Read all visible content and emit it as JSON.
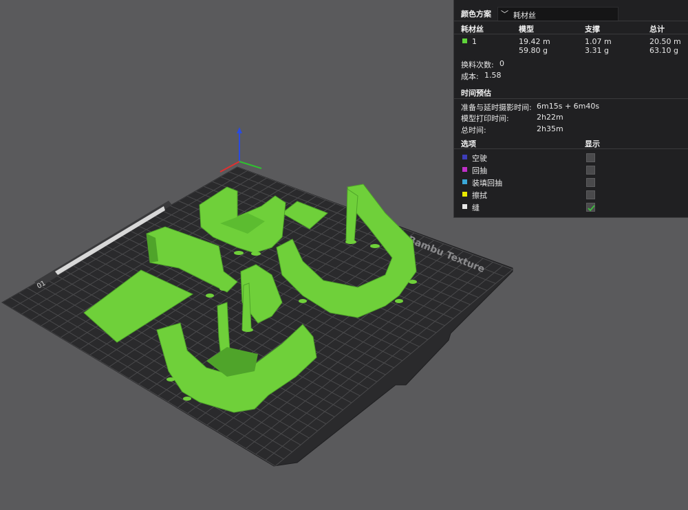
{
  "scene": {
    "bed_brand_text": "Bambu Texture",
    "plate_number": "01",
    "colors": {
      "background": "#5a5a5c",
      "bed": "#2a2a2c",
      "grid": "#4a4a4c",
      "model": "#6fd03a",
      "model_dark": "#4fa42a"
    }
  },
  "panel": {
    "color_scheme_label": "颜色方案",
    "color_scheme_value": "耗材丝",
    "columns": {
      "filament": "耗材丝",
      "model": "模型",
      "support": "支撑",
      "total": "总计"
    },
    "filament_row": {
      "index": "1",
      "color": "#5fd43a",
      "model_length": "19.42 m",
      "model_weight": "59.80 g",
      "support_length": "1.07 m",
      "support_weight": "3.31 g",
      "total_length": "20.50 m",
      "total_weight": "63.10 g"
    },
    "changes_label": "换料次数:",
    "changes_value": "0",
    "cost_label": "成本:",
    "cost_value": "1.58",
    "time_header": "时间预估",
    "prep_label": "准备与延时摄影时间:",
    "prep_value": "6m15s + 6m40s",
    "print_label": "模型打印时间:",
    "print_value": "2h22m",
    "total_time_label": "总时间:",
    "total_time_value": "2h35m",
    "options_header": "选项",
    "display_header": "显示",
    "options": [
      {
        "label": "空驶",
        "color": "#3d3db8",
        "checked": false
      },
      {
        "label": "回抽",
        "color": "#c030c8",
        "checked": false
      },
      {
        "label": "装填回抽",
        "color": "#3aa8d8",
        "checked": false
      },
      {
        "label": "擦拭",
        "color": "#e8e800",
        "checked": false
      },
      {
        "label": "缝",
        "color": "#e8e8e8",
        "checked": true
      }
    ]
  }
}
